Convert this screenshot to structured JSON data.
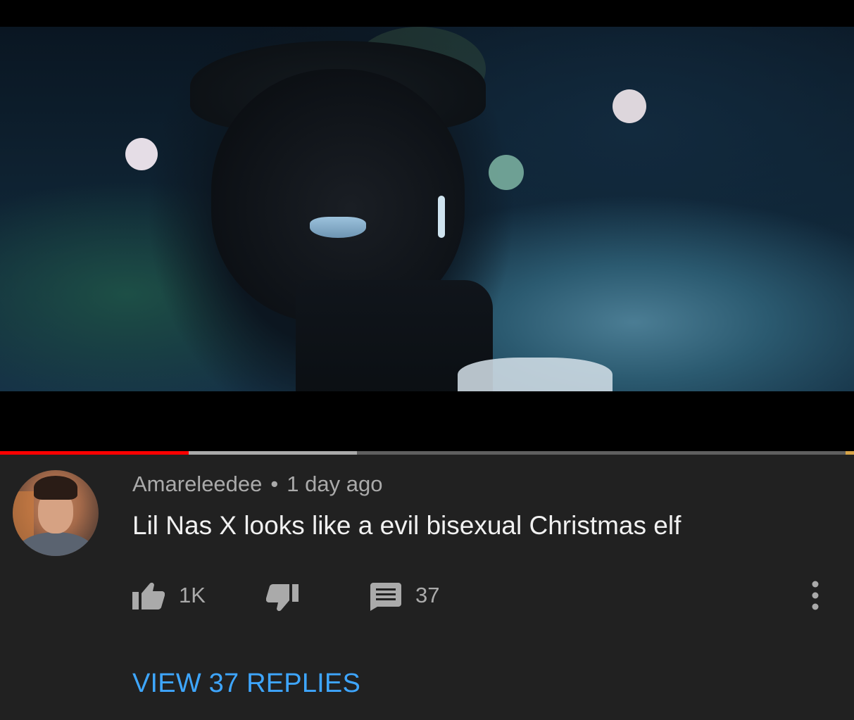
{
  "video": {
    "progress_played_fraction": 0.221,
    "progress_buffered_fraction": 0.418
  },
  "comment": {
    "author": "Amareleedee",
    "separator": "•",
    "age": "1 day ago",
    "text": "Lil Nas X looks like a evil bisexual Christmas elf",
    "like_count": "1K",
    "reply_count": "37",
    "view_replies_label": "VIEW 37 REPLIES"
  },
  "icons": {
    "like": "thumbs-up-icon",
    "dislike": "thumbs-down-icon",
    "reply": "comment-icon",
    "more": "more-vertical-icon"
  },
  "colors": {
    "background": "#212121",
    "progress_played": "#ff0000",
    "progress_buffer": "#aaaaaa",
    "link": "#3ea6ff",
    "secondary_text": "#aaaaaa",
    "primary_text": "#f1f1f1"
  }
}
